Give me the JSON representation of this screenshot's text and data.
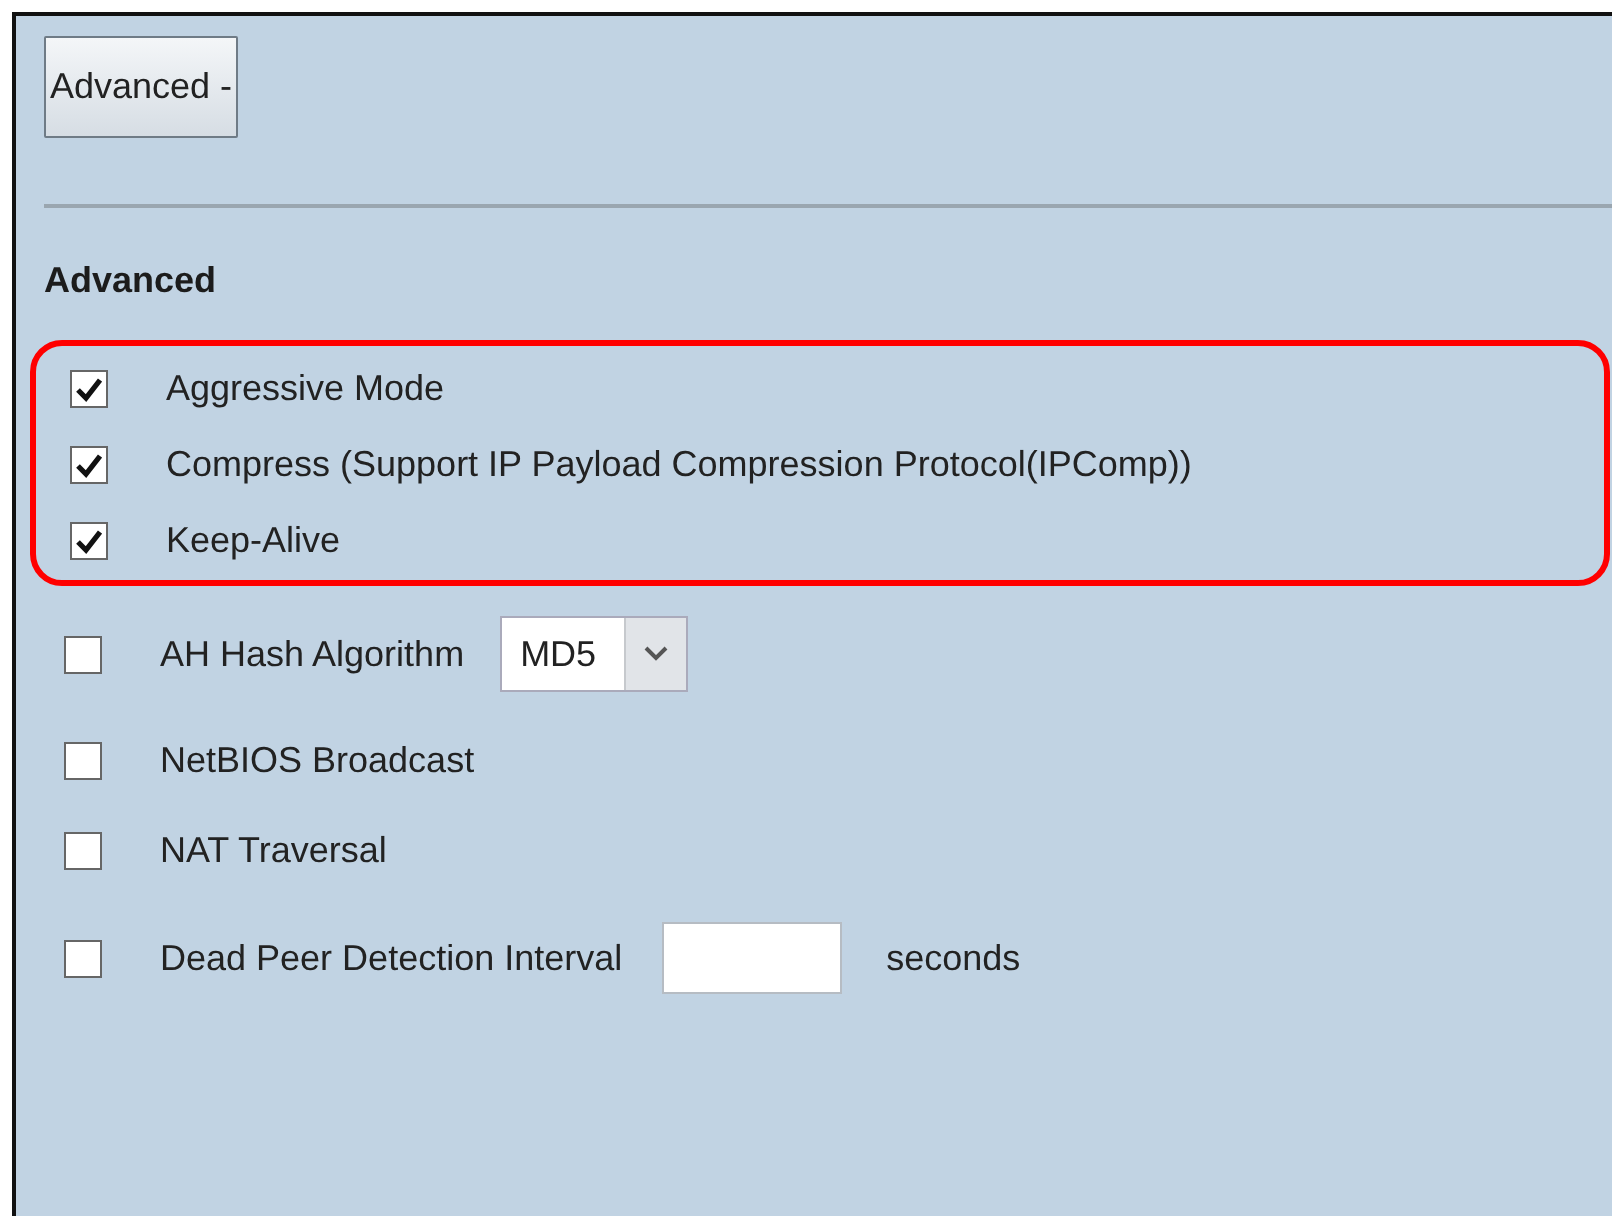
{
  "toggle_button": {
    "label": "Advanced -"
  },
  "section_title": "Advanced",
  "highlighted_options": [
    {
      "kind": "checkbox",
      "label": "Aggressive Mode",
      "checked": true
    },
    {
      "kind": "checkbox",
      "label": "Compress (Support IP Payload Compression Protocol(IPComp))",
      "checked": true
    },
    {
      "kind": "checkbox",
      "label": "Keep-Alive",
      "checked": true
    }
  ],
  "options": [
    {
      "kind": "select",
      "label": "AH Hash Algorithm",
      "checked": false,
      "value": "MD5"
    },
    {
      "kind": "checkbox",
      "label": "NetBIOS Broadcast",
      "checked": false
    },
    {
      "kind": "checkbox",
      "label": "NAT Traversal",
      "checked": false
    },
    {
      "kind": "input",
      "label": "Dead Peer Detection Interval",
      "checked": false,
      "unit": "seconds"
    }
  ]
}
